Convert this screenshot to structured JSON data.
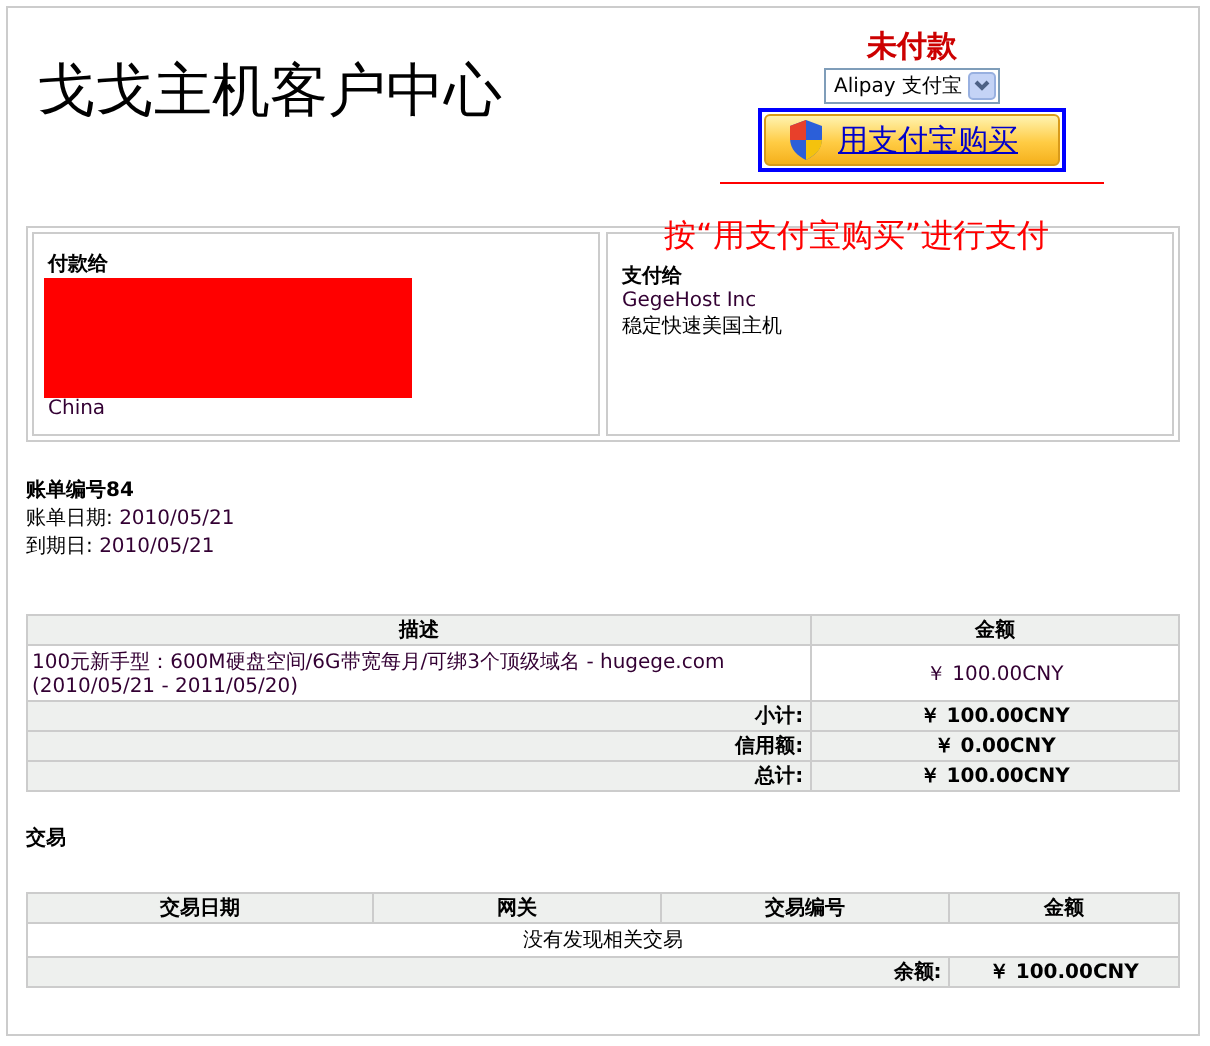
{
  "header": {
    "title": "戈戈主机客户中心",
    "status": "未付款",
    "gateway": {
      "value": "Alipay 支付宝"
    },
    "pay_button": {
      "label": "用支付宝购买"
    },
    "annotation": "按“用支付宝购买”进行支付"
  },
  "parties": [
    {
      "title": "付款给",
      "redacted": true,
      "lines": [
        "China"
      ]
    },
    {
      "title": "支付给",
      "redacted": false,
      "lines": [
        "GegeHost Inc",
        "稳定快速美国主机"
      ]
    }
  ],
  "invoice": {
    "number": "账单编号84",
    "fields": [
      {
        "label": "账单日期:",
        "value": "2010/05/21"
      },
      {
        "label": "到期日:",
        "value": "2010/05/21"
      }
    ]
  },
  "items": {
    "columns": [
      "描述",
      "金额"
    ],
    "rows": [
      {
        "description": "100元新手型：600M硬盘空间/6G带宽每月/可绑3个顶级域名  - hugege.com (2010/05/21 - 2011/05/20)",
        "amount": "￥ 100.00CNY"
      }
    ],
    "totals": [
      {
        "label": "小计:",
        "value": "￥ 100.00CNY"
      },
      {
        "label": "信用额:",
        "value": "￥ 0.00CNY"
      },
      {
        "label": "总计:",
        "value": "￥ 100.00CNY"
      }
    ]
  },
  "transactions": {
    "title": "交易",
    "columns": [
      "交易日期",
      "网关",
      "交易编号",
      "金额"
    ],
    "empty_message": "没有发现相关交易",
    "balance": {
      "label": "余额:",
      "value": "￥ 100.00CNY"
    }
  }
}
